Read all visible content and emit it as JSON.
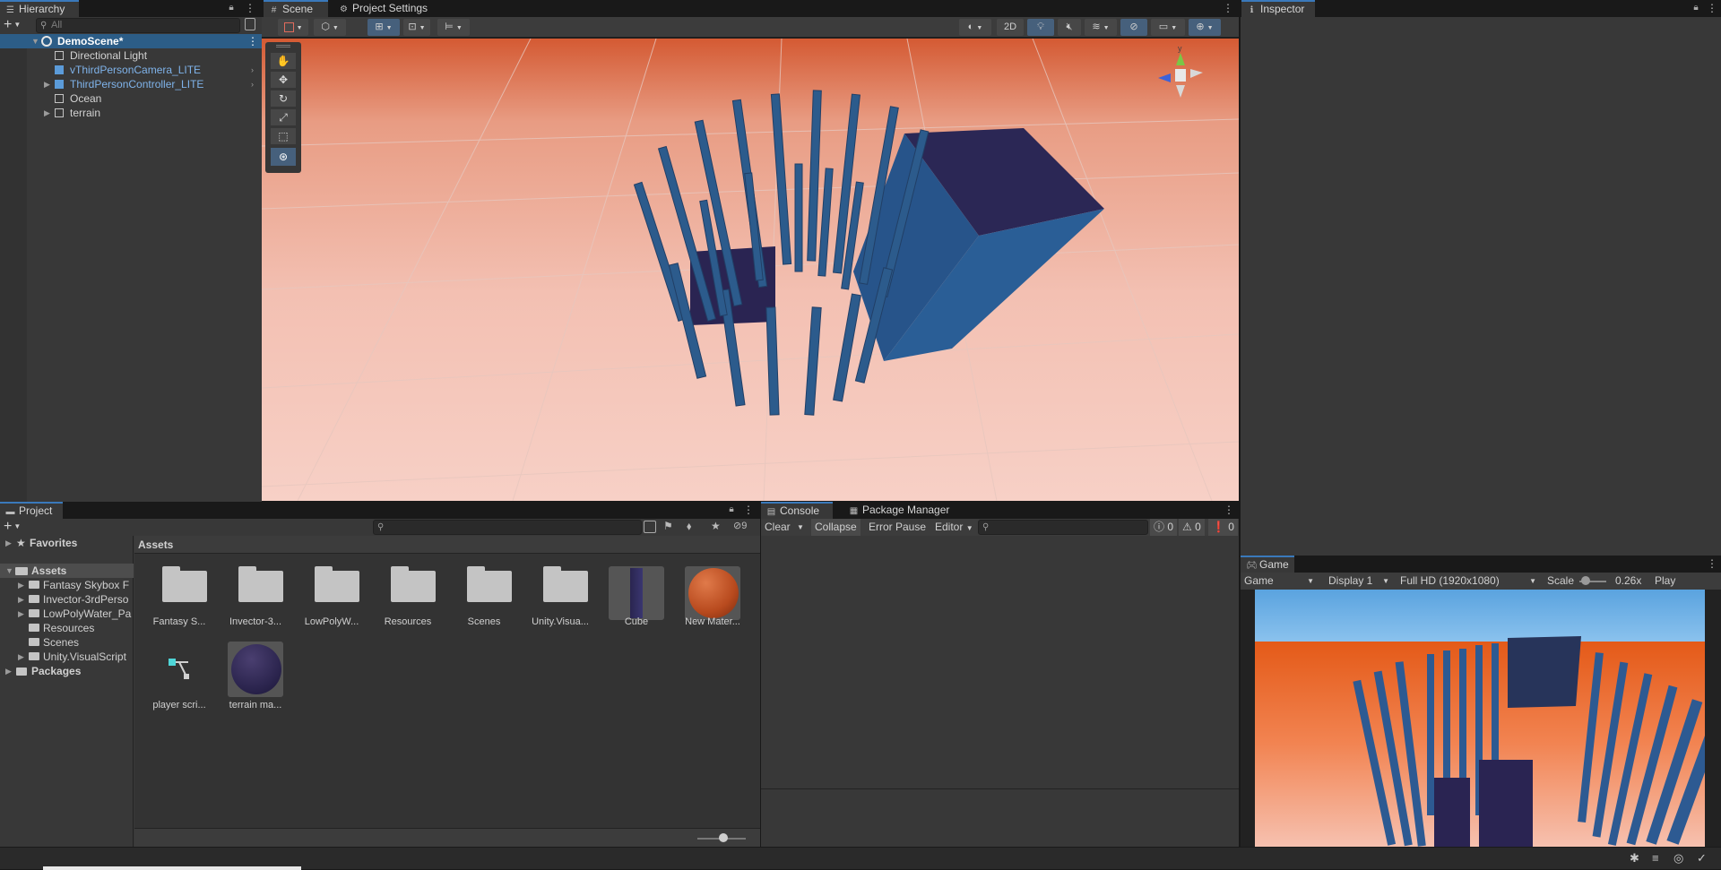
{
  "hierarchy": {
    "tab_label": "Hierarchy",
    "search_placeholder": "All",
    "add_label": "+",
    "items": [
      {
        "label": "DemoScene*"
      },
      {
        "label": "Directional Light"
      },
      {
        "label": "vThirdPersonCamera_LITE"
      },
      {
        "label": "ThirdPersonController_LITE"
      },
      {
        "label": "Ocean"
      },
      {
        "label": "terrain"
      }
    ]
  },
  "scene": {
    "tabs": [
      {
        "label": "Scene"
      },
      {
        "label": "Project Settings"
      }
    ],
    "toolbar": {
      "mode_2d": "2D"
    },
    "gizmo_axis_label": "y",
    "tools": [
      "hand-tool",
      "move-tool",
      "rotate-tool",
      "scale-tool",
      "rect-tool",
      "transform-tool"
    ]
  },
  "inspector": {
    "tab_label": "Inspector"
  },
  "project": {
    "tab_label": "Project",
    "hidden_count": "9",
    "favorites_label": "Favorites",
    "assets_root_label": "Assets",
    "packages_label": "Packages",
    "breadcrumb": "Assets",
    "tree": [
      {
        "label": "Fantasy Skybox F"
      },
      {
        "label": "Invector-3rdPerso"
      },
      {
        "label": "LowPolyWater_Pa"
      },
      {
        "label": "Resources"
      },
      {
        "label": "Scenes"
      },
      {
        "label": "Unity.VisualScript"
      }
    ],
    "assets": [
      {
        "label": "Fantasy S...",
        "kind": "folder"
      },
      {
        "label": "Invector-3...",
        "kind": "folder"
      },
      {
        "label": "LowPolyW...",
        "kind": "folder"
      },
      {
        "label": "Resources",
        "kind": "folder"
      },
      {
        "label": "Scenes",
        "kind": "folder"
      },
      {
        "label": "Unity.Visua...",
        "kind": "folder"
      },
      {
        "label": "Cube",
        "kind": "prefab"
      },
      {
        "label": "New Mater...",
        "kind": "material"
      },
      {
        "label": "player scri...",
        "kind": "script"
      },
      {
        "label": "terrain ma...",
        "kind": "material"
      }
    ]
  },
  "console": {
    "tabs": [
      {
        "label": "Console"
      },
      {
        "label": "Package Manager"
      }
    ],
    "clear_label": "Clear",
    "collapse_label": "Collapse",
    "error_pause_label": "Error Pause",
    "editor_label": "Editor",
    "log_count": "0",
    "warning_count": "0",
    "error_count": "0"
  },
  "game": {
    "tab_label": "Game",
    "view_label": "Game",
    "display_label": "Display 1",
    "resolution_label": "Full HD (1920x1080)",
    "scale_label": "Scale",
    "scale_value": "0.26x",
    "play_focused_label": "Play Focused"
  },
  "colors": {
    "accent": "#3a79bb",
    "selection": "#2c5d87",
    "panel": "#383838",
    "header": "#191919"
  }
}
